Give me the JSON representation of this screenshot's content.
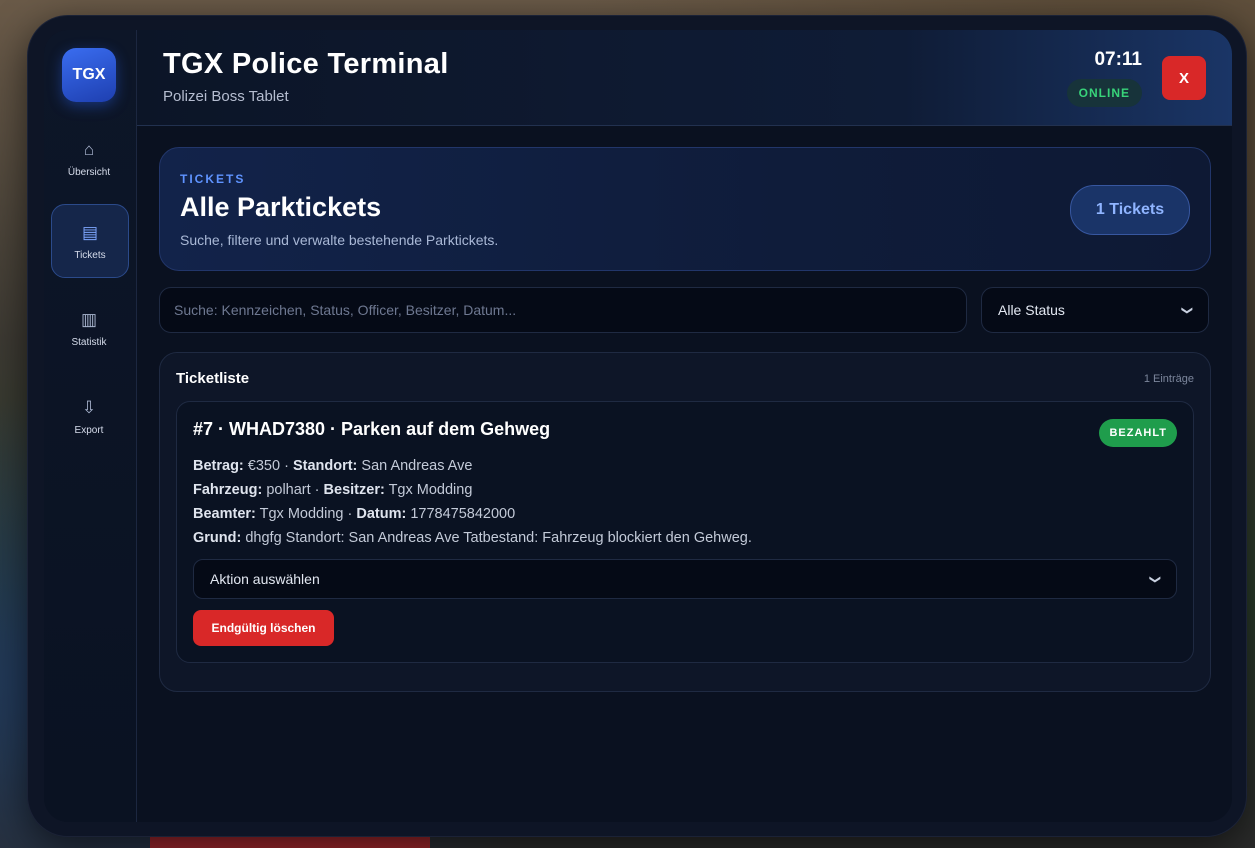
{
  "sidebar": {
    "logo": "TGX",
    "items": [
      {
        "label": "Übersicht",
        "icon": "home-icon",
        "glyph": "⌂"
      },
      {
        "label": "Tickets",
        "icon": "list-icon",
        "glyph": "▤"
      },
      {
        "label": "Statistik",
        "icon": "chart-icon",
        "glyph": "▥"
      },
      {
        "label": "Export",
        "icon": "download-icon",
        "glyph": "⇩"
      }
    ]
  },
  "header": {
    "title": "TGX Police Terminal",
    "subtitle": "Polizei Boss Tablet",
    "time": "07:11",
    "status": "ONLINE",
    "close_label": "X"
  },
  "hero": {
    "kicker": "TICKETS",
    "title": "Alle Parktickets",
    "description": "Suche, filtere und verwalte bestehende Parktickets.",
    "count_label": "1 Tickets"
  },
  "filters": {
    "search_placeholder": "Suche: Kennzeichen, Status, Officer, Besitzer, Datum...",
    "search_value": "",
    "status_selected": "Alle Status"
  },
  "ticket_list": {
    "title": "Ticketliste",
    "count": "1 Einträge",
    "tickets": [
      {
        "heading": "#7 · WHAD7380 · Parken auf dem Gehweg",
        "status": "BEZAHLT",
        "betrag_label": "Betrag:",
        "betrag": "€350",
        "standort_label": "Standort:",
        "standort": "San Andreas Ave",
        "fahrzeug_label": "Fahrzeug:",
        "fahrzeug": "polhart",
        "besitzer_label": "Besitzer:",
        "besitzer": "Tgx Modding",
        "beamter_label": "Beamter:",
        "beamter": "Tgx Modding",
        "datum_label": "Datum:",
        "datum": "1778475842000",
        "grund_label": "Grund:",
        "grund": "dhgfg Standort: San Andreas Ave Tatbestand: Fahrzeug blockiert den Gehweg.",
        "action_selected": "Aktion auswählen",
        "delete_label": "Endgültig löschen"
      }
    ]
  },
  "colors": {
    "accent": "#3a6df0",
    "danger": "#d92828",
    "success": "#1f9d4c",
    "online": "#38d47a"
  }
}
